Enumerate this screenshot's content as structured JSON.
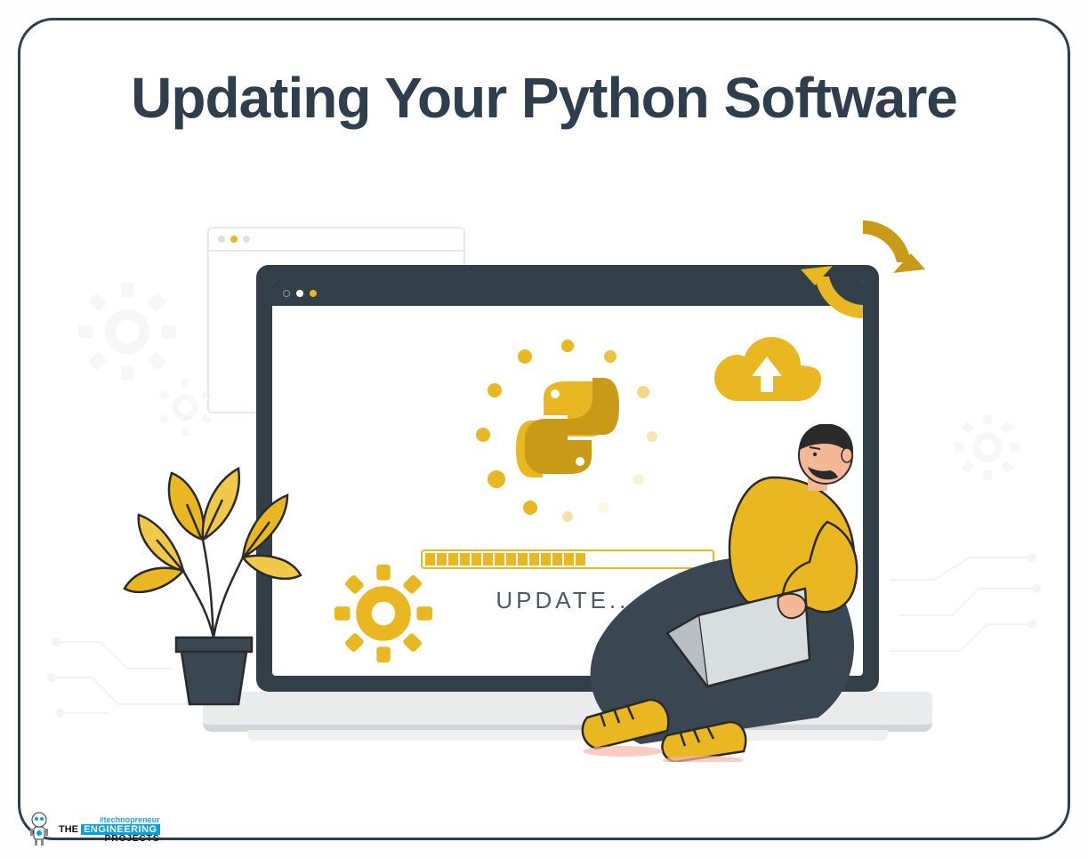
{
  "title": "Updating Your Python Software",
  "screen": {
    "update_label": "UPDATE...",
    "progress_segments": 14
  },
  "icons": {
    "python": "python-logo-icon",
    "cloud": "cloud-upload-icon",
    "gear": "gear-icon",
    "refresh": "refresh-arrows-icon"
  },
  "logo": {
    "hashtag": "#technopreneur",
    "line1_pre": "THE",
    "line1_eng": "ENGINEERING",
    "line2": "PROJECTS"
  },
  "colors": {
    "dark": "#323e48",
    "yellow": "#e8b721",
    "yellow_dark": "#c89a18"
  }
}
